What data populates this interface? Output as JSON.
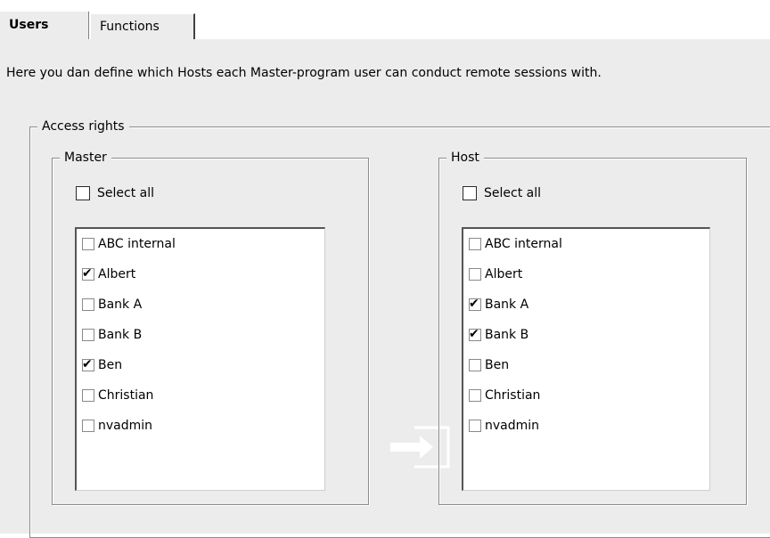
{
  "tabs": [
    {
      "label": "Users"
    },
    {
      "label": "Functions"
    }
  ],
  "intro_text": "Here you dan define which Hosts each Master-program user can conduct remote sessions with.",
  "access_rights": {
    "legend": "Access rights",
    "master": {
      "legend": "Master",
      "select_all_label": "Select all",
      "select_all_checked": false,
      "items": [
        {
          "label": "ABC internal",
          "checked": false
        },
        {
          "label": "Albert",
          "checked": true
        },
        {
          "label": "Bank A",
          "checked": false
        },
        {
          "label": "Bank B",
          "checked": false
        },
        {
          "label": "Ben",
          "checked": true
        },
        {
          "label": "Christian",
          "checked": false
        },
        {
          "label": "nvadmin",
          "checked": false
        }
      ]
    },
    "host": {
      "legend": "Host",
      "select_all_label": "Select all",
      "select_all_checked": false,
      "items": [
        {
          "label": "ABC internal",
          "checked": false
        },
        {
          "label": "Albert",
          "checked": false
        },
        {
          "label": "Bank A",
          "checked": true
        },
        {
          "label": "Bank B",
          "checked": true
        },
        {
          "label": "Ben",
          "checked": false
        },
        {
          "label": "Christian",
          "checked": false
        },
        {
          "label": "nvadmin",
          "checked": false
        }
      ]
    },
    "transfer_icon": "arrow-right-icon"
  },
  "colors": {
    "panel_bg": "#ececec",
    "border": "#8c8c8c",
    "arrow": "#ffffff"
  }
}
